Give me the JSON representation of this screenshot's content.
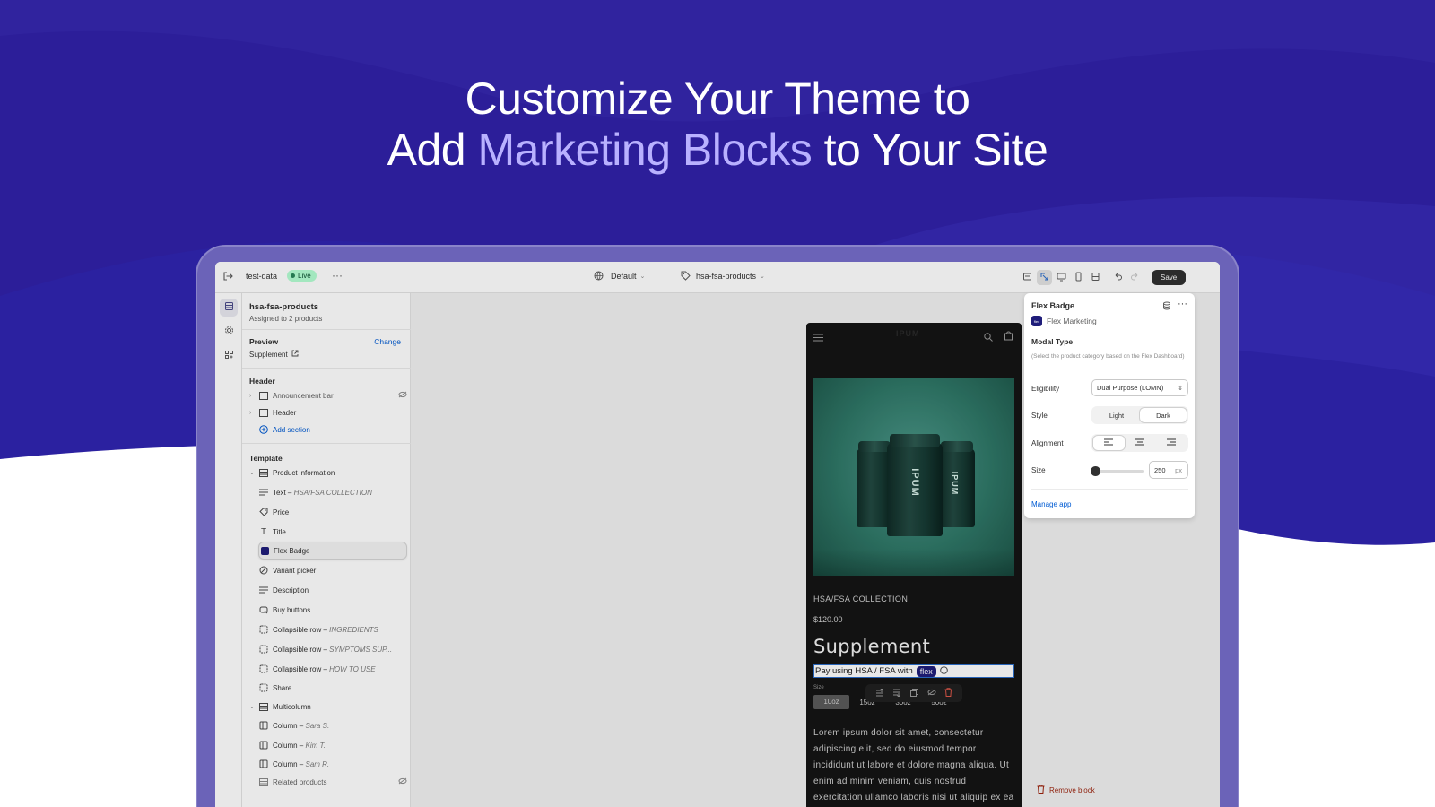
{
  "headline": {
    "line1": "Customize Your Theme to",
    "line2_pre": "Add ",
    "line2_accent": "Marketing Blocks",
    "line2_post": " to Your Site"
  },
  "topbar": {
    "store_name": "test-data",
    "status": "Live",
    "theme_label": "Default",
    "template_label": "hsa-fsa-products",
    "save_label": "Save"
  },
  "sidebar": {
    "template_name": "hsa-fsa-products",
    "assigned": "Assigned to 2 products",
    "preview_label": "Preview",
    "change_link": "Change",
    "preview_value": "Supplement",
    "header_group": "Header",
    "header_items": [
      {
        "label": "Announcement bar"
      },
      {
        "label": "Header"
      }
    ],
    "add_section": "Add section",
    "template_group": "Template",
    "product_info": "Product information",
    "blocks": [
      {
        "label": "Text",
        "sub": "HSA/FSA COLLECTION"
      },
      {
        "label": "Price",
        "sub": ""
      },
      {
        "label": "Title",
        "sub": ""
      },
      {
        "label": "Flex Badge",
        "sub": ""
      },
      {
        "label": "Variant picker",
        "sub": ""
      },
      {
        "label": "Description",
        "sub": ""
      },
      {
        "label": "Buy buttons",
        "sub": ""
      },
      {
        "label": "Collapsible row",
        "sub": "INGREDIENTS"
      },
      {
        "label": "Collapsible row",
        "sub": "SYMPTOMS SUP..."
      },
      {
        "label": "Collapsible row",
        "sub": "HOW TO USE"
      },
      {
        "label": "Share",
        "sub": ""
      }
    ],
    "multicolumn": "Multicolumn",
    "columns": [
      {
        "label": "Column",
        "sub": "Sara S."
      },
      {
        "label": "Column",
        "sub": "Kim T."
      },
      {
        "label": "Column",
        "sub": "Sam R."
      }
    ],
    "related": "Related products"
  },
  "preview": {
    "brand": "IPUM",
    "collection": "HSA/FSA COLLECTION",
    "price": "$120.00",
    "title": "Supplement",
    "badge_text": "Pay using HSA / FSA with",
    "badge_pill": "flex",
    "size_label": "Size",
    "sizes": [
      "10oz",
      "15oz",
      "30oz",
      "50oz"
    ],
    "description": "Lorem ipsum dolor sit amet, consectetur adipiscing elit, sed do eiusmod tempor incididunt ut labore et dolore magna aliqua. Ut enim ad minim veniam, quis nostrud exercitation ullamco laboris nisi ut aliquip ex ea commodo consequat."
  },
  "panel": {
    "title": "Flex Badge",
    "app_name": "Flex Marketing",
    "app_icon_text": "flex",
    "section_title": "Modal Type",
    "help": "(Select the product category based on the Flex Dashboard)",
    "eligibility_label": "Eligibility",
    "eligibility_value": "Dual Purpose (LOMN)",
    "style_label": "Style",
    "style_options": [
      "Light",
      "Dark"
    ],
    "style_selected": "Dark",
    "alignment_label": "Alignment",
    "alignment_selected": "left",
    "size_label": "Size",
    "size_value": "250",
    "size_unit": "px",
    "manage_link": "Manage app",
    "remove_label": "Remove block"
  },
  "colors": {
    "brand_dark": "#1c1a8e",
    "accent_text": "#b9b1ff",
    "flex_pill": "#1f1d7a",
    "live_bg": "#b4fed2"
  }
}
